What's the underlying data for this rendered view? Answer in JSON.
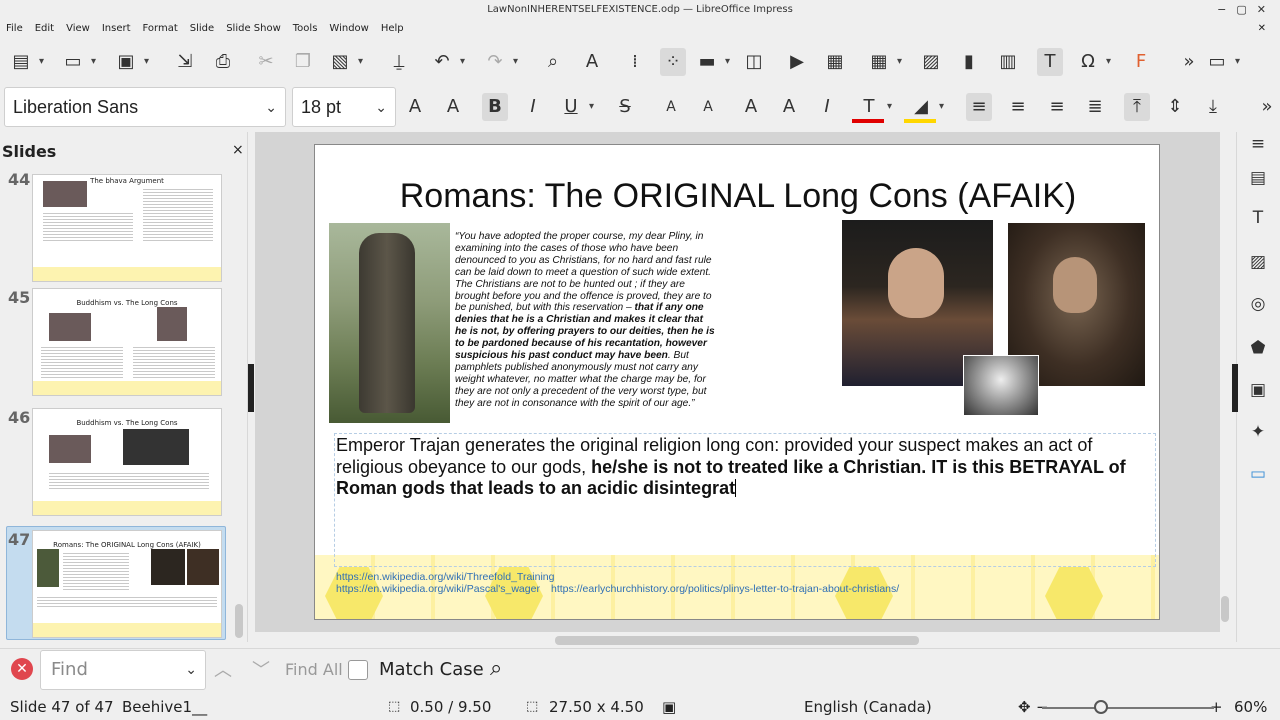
{
  "window": {
    "title": "LawNonINHERENTSELFEXISTENCE.odp — LibreOffice Impress",
    "controls": [
      "−",
      "▢",
      "✕"
    ]
  },
  "menu": [
    "File",
    "Edit",
    "View",
    "Insert",
    "Format",
    "Slide",
    "Slide Show",
    "Tools",
    "Window",
    "Help"
  ],
  "menu_close": "✕",
  "formatting": {
    "font_name": "Liberation Sans",
    "font_size": "18 pt"
  },
  "slides_panel": {
    "title": "Slides",
    "close": "×",
    "thumbnails": [
      {
        "number": "44",
        "title": "The bhava Argument"
      },
      {
        "number": "45",
        "title": "Buddhism vs. The Long Cons"
      },
      {
        "number": "46",
        "title": "Buddhism vs. The Long Cons"
      },
      {
        "number": "47",
        "title": "Romans: The ORIGINAL Long Cons (AFAIK)"
      }
    ]
  },
  "slide": {
    "title": "Romans: The ORIGINAL Long Cons (AFAIK)",
    "quote_normal_1": "“You have adopted the proper course, my dear Pliny, in examining into the cases of those who have been denounced to you as Christians, for no hard and fast rule can be laid down to meet a question of such wide extent. The Christians are not to be hunted out ; if they are brought before you and the offence is proved, they are to be punished, but with this reservation – ",
    "quote_bold": "that if any one denies that he is a Christian and makes it clear that he is not, by offering prayers to our deities, then he is to be pardoned because of his recantation, however suspicious his past conduct may have been",
    "quote_normal_2": ". But pamphlets published anonymously must not carry any weight whatever, no matter what the charge may be, for they are not only a precedent of the very worst type, but they are not in consonance with the spirit of our age.”",
    "body_normal": "Emperor Trajan generates the original religion long con: provided your suspect makes an act of religious obeyance to our gods, ",
    "body_bold": "he/she is not to treated like a Christian. IT is this BETRAYAL of Roman gods that leads to an acidic disintegrat",
    "links": [
      "https://en.wikipedia.org/wiki/Threefold_Training",
      "https://en.wikipedia.org/wiki/Pascal's_wager",
      "https://earlychurchhistory.org/politics/plinys-letter-to-trajan-about-christians/"
    ]
  },
  "find_bar": {
    "close": "✕",
    "placeholder": "Find",
    "find_all": "Find All",
    "match_case": "Match Case"
  },
  "status_bar": {
    "slide": "Slide 47 of 47",
    "master": "Beehive1__",
    "position": "0.50 / 9.50",
    "size": "27.50 x 4.50",
    "language": "English (Canada)",
    "zoom_level": "60%",
    "zoom_minus": "−",
    "zoom_plus": "+"
  },
  "colors": {
    "accent_selection": "#c4dcef",
    "font_color_bar": "#e00000",
    "highlight_bar": "#ffd700",
    "link": "#2f6fb5",
    "honeycomb": "#fdf3b0"
  }
}
